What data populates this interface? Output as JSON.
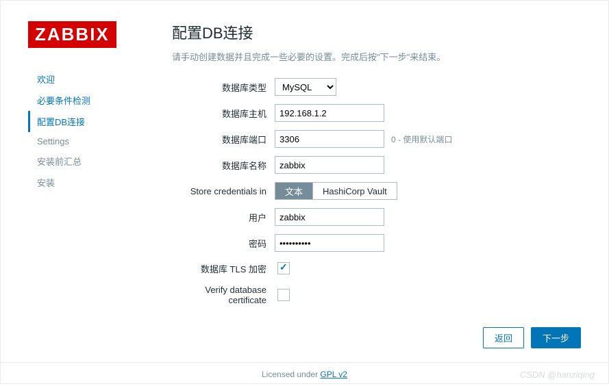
{
  "logo": "ZABBIX",
  "nav": {
    "items": [
      {
        "label": "欢迎",
        "status": "done"
      },
      {
        "label": "必要条件检测",
        "status": "done"
      },
      {
        "label": "配置DB连接",
        "status": "active"
      },
      {
        "label": "Settings",
        "status": "pending"
      },
      {
        "label": "安装前汇总",
        "status": "pending"
      },
      {
        "label": "安装",
        "status": "pending"
      }
    ]
  },
  "main": {
    "title": "配置DB连接",
    "subtitle": "请手动创建数据并且完成一些必要的设置。完成后按\"下一步\"来结束。",
    "fields": {
      "db_type": {
        "label": "数据库类型",
        "value": "MySQL"
      },
      "db_host": {
        "label": "数据库主机",
        "value": "192.168.1.2"
      },
      "db_port": {
        "label": "数据库端口",
        "value": "3306",
        "hint": "0 - 使用默认端口"
      },
      "db_name": {
        "label": "数据库名称",
        "value": "zabbix"
      },
      "store_cred": {
        "label": "Store credentials in",
        "opt1": "文本",
        "opt2": "HashiCorp Vault"
      },
      "user": {
        "label": "用户",
        "value": "zabbix"
      },
      "password": {
        "label": "密码",
        "value": "••••••••••"
      },
      "tls": {
        "label": "数据库 TLS 加密",
        "checked": true
      },
      "verify": {
        "label": "Verify database certificate",
        "checked": false
      }
    }
  },
  "buttons": {
    "back": "返回",
    "next": "下一步"
  },
  "license": {
    "prefix": "Licensed under ",
    "link": "GPL v2"
  },
  "watermark": "CSDN @hanziqing"
}
